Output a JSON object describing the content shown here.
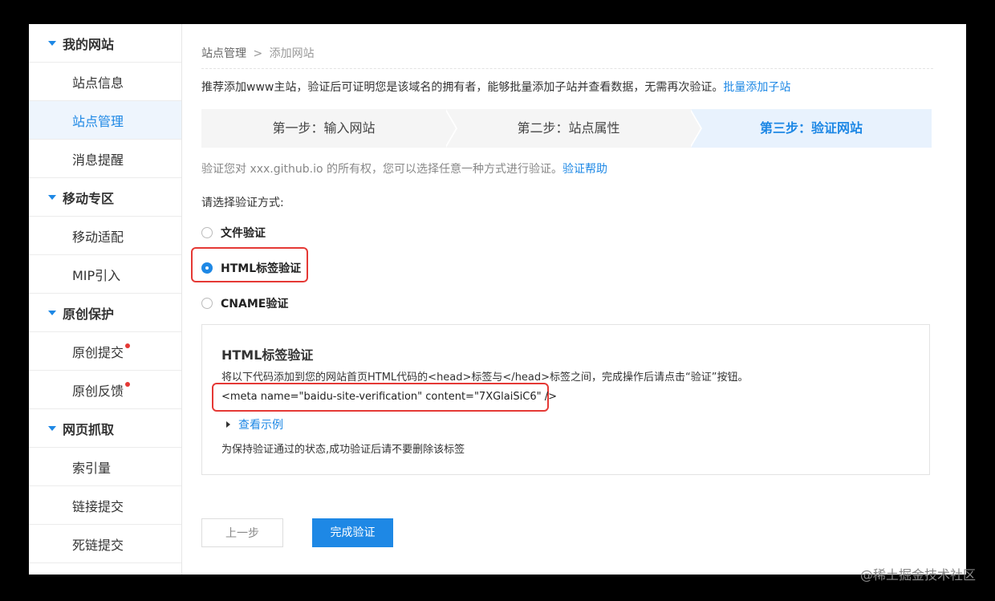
{
  "sidebar": {
    "groups": [
      {
        "label": "我的网站",
        "items": [
          {
            "label": "站点信息"
          },
          {
            "label": "站点管理"
          },
          {
            "label": "消息提醒"
          }
        ]
      },
      {
        "label": "移动专区",
        "items": [
          {
            "label": "移动适配"
          },
          {
            "label": "MIP引入"
          }
        ]
      },
      {
        "label": "原创保护",
        "items": [
          {
            "label": "原创提交"
          },
          {
            "label": "原创反馈"
          }
        ]
      },
      {
        "label": "网页抓取",
        "items": [
          {
            "label": "索引量"
          },
          {
            "label": "链接提交"
          },
          {
            "label": "死链提交"
          }
        ]
      }
    ]
  },
  "breadcrumb": {
    "parent": "站点管理",
    "separator": ">",
    "current": "添加网站"
  },
  "intro": {
    "text": "推荐添加www主站，验证后可证明您是该域名的拥有者，能够批量添加子站并查看数据，无需再次验证。",
    "link": "批量添加子站"
  },
  "steps": [
    "第一步：输入网站",
    "第二步：站点属性",
    "第三步：验证网站"
  ],
  "verify_own": {
    "text": "验证您对 xxx.github.io 的所有权，您可以选择任意一种方式进行验证。",
    "link": "验证帮助"
  },
  "choose_label": "请选择验证方式:",
  "methods": [
    {
      "label": "文件验证",
      "selected": false
    },
    {
      "label": "HTML标签验证",
      "selected": true
    },
    {
      "label": "CNAME验证",
      "selected": false
    }
  ],
  "panel": {
    "title": "HTML标签验证",
    "desc": "将以下代码添加到您的网站首页HTML代码的<head>标签与</head>标签之间，完成操作后请点击“验证”按钮。",
    "code": "<meta name=\"baidu-site-verification\" content=\"7XGlaiSiC6\" />",
    "example_link": "查看示例",
    "keep_note": "为保持验证通过的状态,成功验证后请不要删除该标签"
  },
  "buttons": {
    "prev": "上一步",
    "done": "完成验证"
  },
  "watermark": "@稀土掘金技术社区",
  "colors": {
    "accent": "#1e88e5",
    "highlight": "#e53935"
  }
}
